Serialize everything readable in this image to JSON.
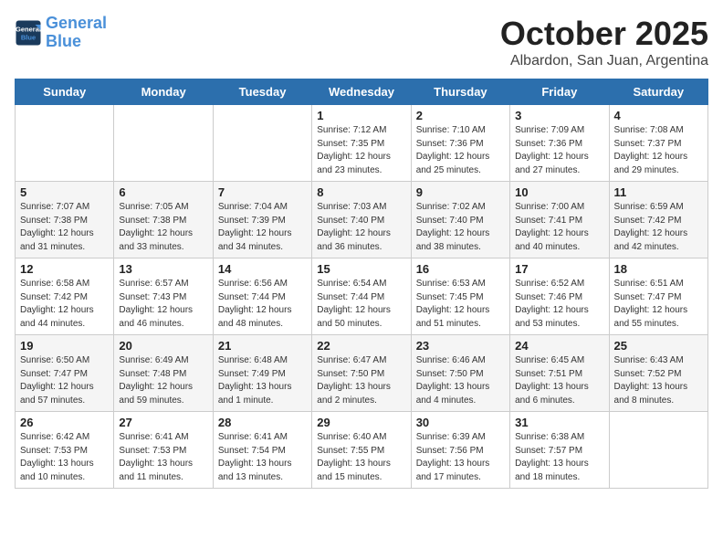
{
  "header": {
    "logo_line1": "General",
    "logo_line2": "Blue",
    "month": "October 2025",
    "location": "Albardon, San Juan, Argentina"
  },
  "weekdays": [
    "Sunday",
    "Monday",
    "Tuesday",
    "Wednesday",
    "Thursday",
    "Friday",
    "Saturday"
  ],
  "weeks": [
    [
      {
        "day": "",
        "info": ""
      },
      {
        "day": "",
        "info": ""
      },
      {
        "day": "",
        "info": ""
      },
      {
        "day": "1",
        "info": "Sunrise: 7:12 AM\nSunset: 7:35 PM\nDaylight: 12 hours\nand 23 minutes."
      },
      {
        "day": "2",
        "info": "Sunrise: 7:10 AM\nSunset: 7:36 PM\nDaylight: 12 hours\nand 25 minutes."
      },
      {
        "day": "3",
        "info": "Sunrise: 7:09 AM\nSunset: 7:36 PM\nDaylight: 12 hours\nand 27 minutes."
      },
      {
        "day": "4",
        "info": "Sunrise: 7:08 AM\nSunset: 7:37 PM\nDaylight: 12 hours\nand 29 minutes."
      }
    ],
    [
      {
        "day": "5",
        "info": "Sunrise: 7:07 AM\nSunset: 7:38 PM\nDaylight: 12 hours\nand 31 minutes."
      },
      {
        "day": "6",
        "info": "Sunrise: 7:05 AM\nSunset: 7:38 PM\nDaylight: 12 hours\nand 33 minutes."
      },
      {
        "day": "7",
        "info": "Sunrise: 7:04 AM\nSunset: 7:39 PM\nDaylight: 12 hours\nand 34 minutes."
      },
      {
        "day": "8",
        "info": "Sunrise: 7:03 AM\nSunset: 7:40 PM\nDaylight: 12 hours\nand 36 minutes."
      },
      {
        "day": "9",
        "info": "Sunrise: 7:02 AM\nSunset: 7:40 PM\nDaylight: 12 hours\nand 38 minutes."
      },
      {
        "day": "10",
        "info": "Sunrise: 7:00 AM\nSunset: 7:41 PM\nDaylight: 12 hours\nand 40 minutes."
      },
      {
        "day": "11",
        "info": "Sunrise: 6:59 AM\nSunset: 7:42 PM\nDaylight: 12 hours\nand 42 minutes."
      }
    ],
    [
      {
        "day": "12",
        "info": "Sunrise: 6:58 AM\nSunset: 7:42 PM\nDaylight: 12 hours\nand 44 minutes."
      },
      {
        "day": "13",
        "info": "Sunrise: 6:57 AM\nSunset: 7:43 PM\nDaylight: 12 hours\nand 46 minutes."
      },
      {
        "day": "14",
        "info": "Sunrise: 6:56 AM\nSunset: 7:44 PM\nDaylight: 12 hours\nand 48 minutes."
      },
      {
        "day": "15",
        "info": "Sunrise: 6:54 AM\nSunset: 7:44 PM\nDaylight: 12 hours\nand 50 minutes."
      },
      {
        "day": "16",
        "info": "Sunrise: 6:53 AM\nSunset: 7:45 PM\nDaylight: 12 hours\nand 51 minutes."
      },
      {
        "day": "17",
        "info": "Sunrise: 6:52 AM\nSunset: 7:46 PM\nDaylight: 12 hours\nand 53 minutes."
      },
      {
        "day": "18",
        "info": "Sunrise: 6:51 AM\nSunset: 7:47 PM\nDaylight: 12 hours\nand 55 minutes."
      }
    ],
    [
      {
        "day": "19",
        "info": "Sunrise: 6:50 AM\nSunset: 7:47 PM\nDaylight: 12 hours\nand 57 minutes."
      },
      {
        "day": "20",
        "info": "Sunrise: 6:49 AM\nSunset: 7:48 PM\nDaylight: 12 hours\nand 59 minutes."
      },
      {
        "day": "21",
        "info": "Sunrise: 6:48 AM\nSunset: 7:49 PM\nDaylight: 13 hours\nand 1 minute."
      },
      {
        "day": "22",
        "info": "Sunrise: 6:47 AM\nSunset: 7:50 PM\nDaylight: 13 hours\nand 2 minutes."
      },
      {
        "day": "23",
        "info": "Sunrise: 6:46 AM\nSunset: 7:50 PM\nDaylight: 13 hours\nand 4 minutes."
      },
      {
        "day": "24",
        "info": "Sunrise: 6:45 AM\nSunset: 7:51 PM\nDaylight: 13 hours\nand 6 minutes."
      },
      {
        "day": "25",
        "info": "Sunrise: 6:43 AM\nSunset: 7:52 PM\nDaylight: 13 hours\nand 8 minutes."
      }
    ],
    [
      {
        "day": "26",
        "info": "Sunrise: 6:42 AM\nSunset: 7:53 PM\nDaylight: 13 hours\nand 10 minutes."
      },
      {
        "day": "27",
        "info": "Sunrise: 6:41 AM\nSunset: 7:53 PM\nDaylight: 13 hours\nand 11 minutes."
      },
      {
        "day": "28",
        "info": "Sunrise: 6:41 AM\nSunset: 7:54 PM\nDaylight: 13 hours\nand 13 minutes."
      },
      {
        "day": "29",
        "info": "Sunrise: 6:40 AM\nSunset: 7:55 PM\nDaylight: 13 hours\nand 15 minutes."
      },
      {
        "day": "30",
        "info": "Sunrise: 6:39 AM\nSunset: 7:56 PM\nDaylight: 13 hours\nand 17 minutes."
      },
      {
        "day": "31",
        "info": "Sunrise: 6:38 AM\nSunset: 7:57 PM\nDaylight: 13 hours\nand 18 minutes."
      },
      {
        "day": "",
        "info": ""
      }
    ]
  ]
}
